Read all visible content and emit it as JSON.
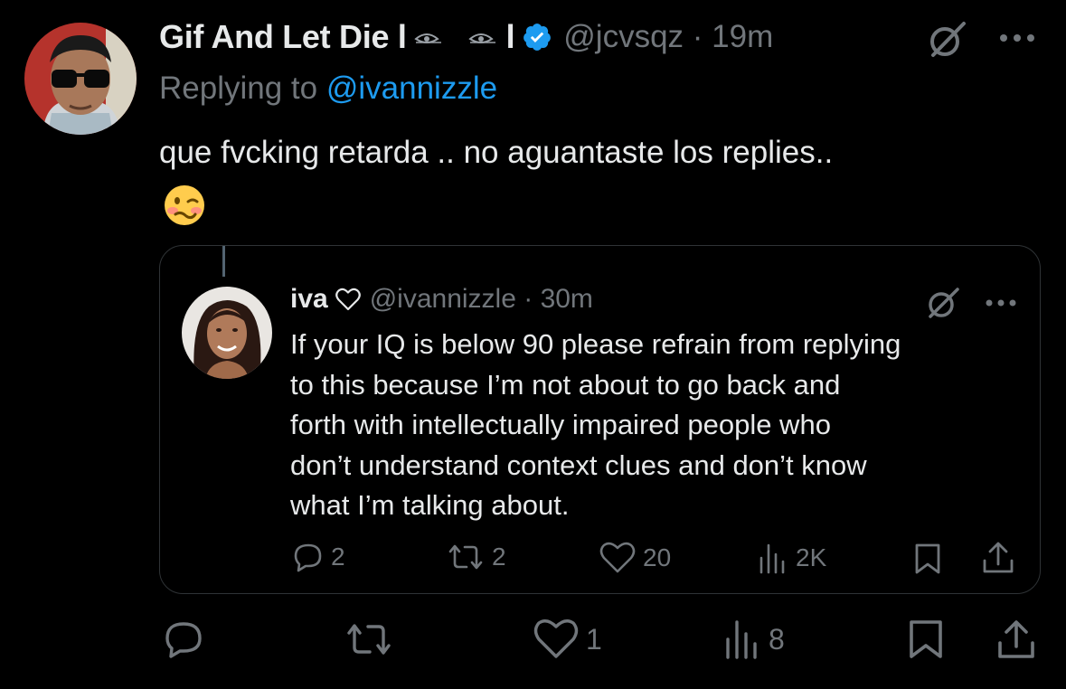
{
  "tweet": {
    "author_name": "Gif And Let Die l",
    "author_handle_time": "@jcvsqz · 19m",
    "replying_prefix": "Replying to",
    "replying_to": "@ivannizzle",
    "text": "que fvcking retarda .. no aguantaste los replies..",
    "emoji": "woozy-face",
    "actions": {
      "reply_count": "",
      "retweet_count": "",
      "like_count": "1",
      "views_count": "8"
    }
  },
  "quoted_tweet": {
    "author_name": "iva",
    "author_handle_time": "@ivannizzle · 30m",
    "text_lines": [
      "If your IQ is below 90 please refrain from replying",
      "to this because I’m not about to go back and",
      "forth with intellectually impaired people who",
      "don’t understand context clues and don’t know",
      "what I’m talking about."
    ],
    "actions": {
      "reply_count": "2",
      "retweet_count": "2",
      "like_count": "20",
      "views_count": "2K"
    }
  },
  "colors": {
    "background": "#000000",
    "text_primary": "#e7e9ea",
    "text_secondary": "#71767b",
    "accent": "#1d9bf0",
    "border": "#2f3336"
  },
  "icons": [
    "verified-badge-icon",
    "grok-icon",
    "more-icon",
    "heart-outline-icon",
    "reply-icon",
    "retweet-icon",
    "like-icon",
    "views-icon",
    "bookmark-icon",
    "share-icon"
  ]
}
